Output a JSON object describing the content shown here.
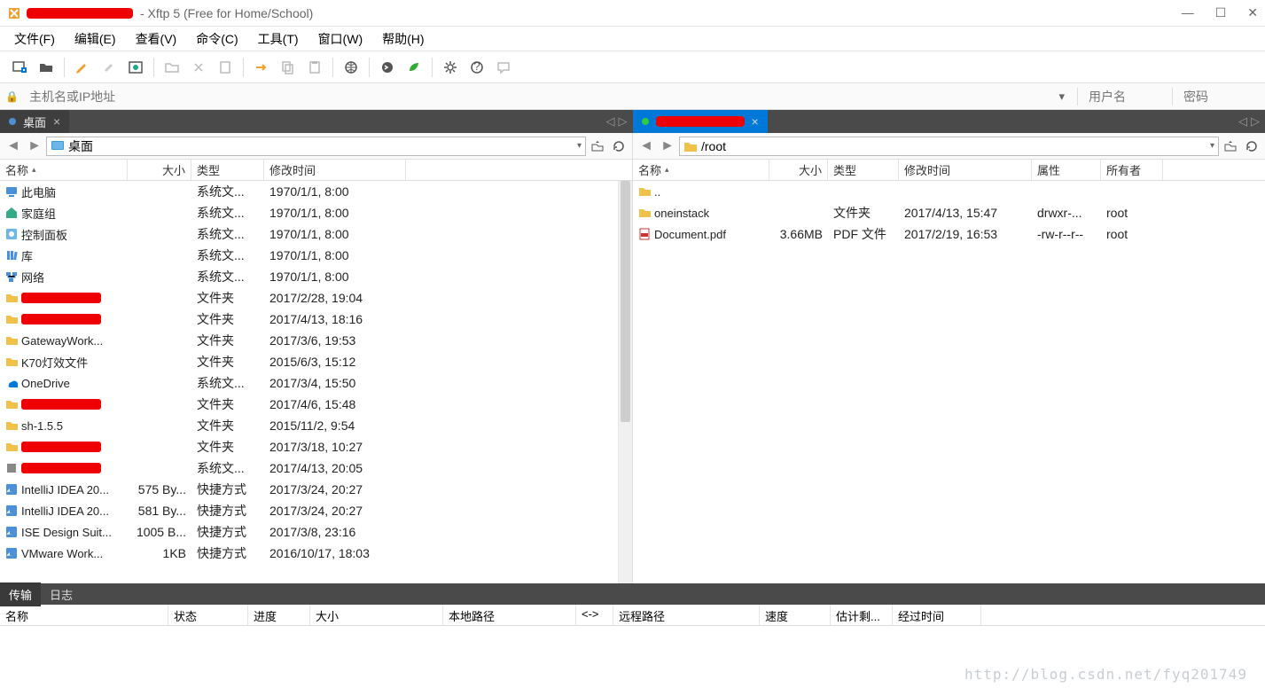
{
  "window": {
    "title": " - Xftp 5 (Free for Home/School)"
  },
  "menu": {
    "file": "文件(F)",
    "edit": "编辑(E)",
    "view": "查看(V)",
    "command": "命令(C)",
    "tool": "工具(T)",
    "window": "窗口(W)",
    "help": "帮助(H)"
  },
  "addressbar": {
    "host_placeholder": "主机名或IP地址",
    "user_placeholder": "用户名",
    "pass_placeholder": "密码"
  },
  "tabs": {
    "local": "桌面",
    "remote_redacted": true
  },
  "local_pane": {
    "path": "桌面",
    "columns": {
      "name": "名称",
      "size": "大小",
      "type": "类型",
      "date": "修改时间"
    },
    "rows": [
      {
        "icon": "pc",
        "name": "此电脑",
        "size": "",
        "type": "系统文...",
        "date": "1970/1/1, 8:00"
      },
      {
        "icon": "home",
        "name": "家庭组",
        "size": "",
        "type": "系统文...",
        "date": "1970/1/1, 8:00"
      },
      {
        "icon": "panel",
        "name": "控制面板",
        "size": "",
        "type": "系统文...",
        "date": "1970/1/1, 8:00"
      },
      {
        "icon": "lib",
        "name": "库",
        "size": "",
        "type": "系统文...",
        "date": "1970/1/1, 8:00"
      },
      {
        "icon": "net",
        "name": "网络",
        "size": "",
        "type": "系统文...",
        "date": "1970/1/1, 8:00"
      },
      {
        "icon": "folder",
        "redacted": true,
        "size": "",
        "type": "文件夹",
        "date": "2017/2/28, 19:04"
      },
      {
        "icon": "folder",
        "redacted": true,
        "size": "",
        "type": "文件夹",
        "date": "2017/4/13, 18:16"
      },
      {
        "icon": "folder",
        "name": "GatewayWork...",
        "size": "",
        "type": "文件夹",
        "date": "2017/3/6, 19:53"
      },
      {
        "icon": "folder",
        "name": "K70灯效文件",
        "size": "",
        "type": "文件夹",
        "date": "2015/6/3, 15:12"
      },
      {
        "icon": "cloud",
        "name": "OneDrive",
        "size": "",
        "type": "系统文...",
        "date": "2017/3/4, 15:50"
      },
      {
        "icon": "folder",
        "redacted": true,
        "size": "",
        "type": "文件夹",
        "date": "2017/4/6, 15:48"
      },
      {
        "icon": "folder",
        "name": "sh-1.5.5",
        "size": "",
        "type": "文件夹",
        "date": "2015/11/2, 9:54"
      },
      {
        "icon": "folder",
        "redacted": true,
        "size": "",
        "type": "文件夹",
        "date": "2017/3/18, 10:27"
      },
      {
        "icon": "sys",
        "redacted": true,
        "size": "",
        "type": "系统文...",
        "date": "2017/4/13, 20:05"
      },
      {
        "icon": "shortcut",
        "name": "IntelliJ IDEA 20...",
        "size": "575 By...",
        "type": "快捷方式",
        "date": "2017/3/24, 20:27"
      },
      {
        "icon": "shortcut",
        "name": "IntelliJ IDEA 20...",
        "size": "581 By...",
        "type": "快捷方式",
        "date": "2017/3/24, 20:27"
      },
      {
        "icon": "shortcut",
        "name": "ISE Design Suit...",
        "size": "1005 B...",
        "type": "快捷方式",
        "date": "2017/3/8, 23:16"
      },
      {
        "icon": "shortcut",
        "name": "VMware Work...",
        "size": "1KB",
        "type": "快捷方式",
        "date": "2016/10/17, 18:03"
      }
    ]
  },
  "remote_pane": {
    "path": "/root",
    "columns": {
      "name": "名称",
      "size": "大小",
      "type": "类型",
      "date": "修改时间",
      "perm": "属性",
      "owner": "所有者"
    },
    "rows": [
      {
        "icon": "folder",
        "name": "..",
        "size": "",
        "type": "",
        "date": "",
        "perm": "",
        "owner": ""
      },
      {
        "icon": "folder",
        "name": "oneinstack",
        "size": "",
        "type": "文件夹",
        "date": "2017/4/13, 15:47",
        "perm": "drwxr-...",
        "owner": "root"
      },
      {
        "icon": "pdf",
        "name": "Document.pdf",
        "size": "3.66MB",
        "type": "PDF 文件",
        "date": "2017/2/19, 16:53",
        "perm": "-rw-r--r--",
        "owner": "root"
      }
    ]
  },
  "bottom": {
    "tab_transfer": "传输",
    "tab_log": "日志",
    "cols": {
      "name": "名称",
      "status": "状态",
      "progress": "进度",
      "size": "大小",
      "local_path": "本地路径",
      "dir": "<->",
      "remote_path": "远程路径",
      "speed": "速度",
      "eta": "估计剩...",
      "elapsed": "经过时间"
    }
  },
  "watermark": "http://blog.csdn.net/fyq201749"
}
